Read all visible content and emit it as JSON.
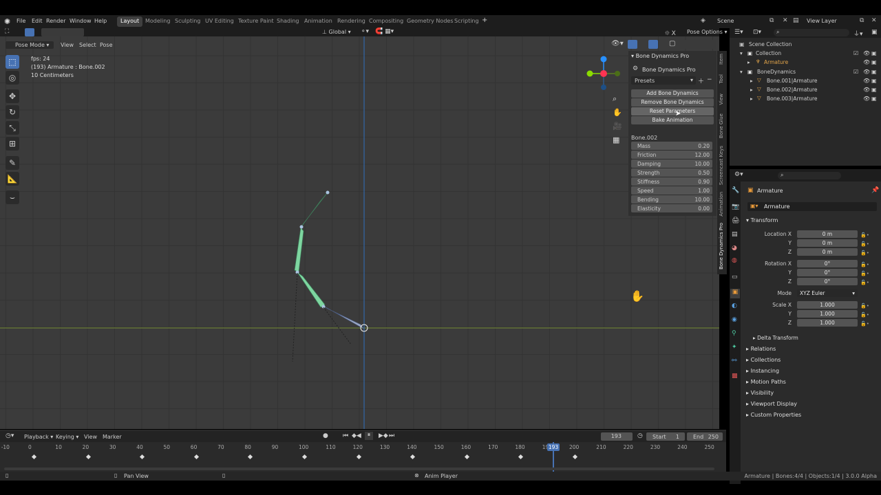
{
  "menu": [
    "File",
    "Edit",
    "Render",
    "Window",
    "Help"
  ],
  "workspaces": [
    {
      "label": "Layout",
      "active": true
    },
    {
      "label": "Modeling"
    },
    {
      "label": "Sculpting"
    },
    {
      "label": "UV Editing"
    },
    {
      "label": "Texture Paint"
    },
    {
      "label": "Shading"
    },
    {
      "label": "Animation"
    },
    {
      "label": "Rendering"
    },
    {
      "label": "Compositing"
    },
    {
      "label": "Geometry Nodes"
    },
    {
      "label": "Scripting"
    }
  ],
  "add_tab": "+",
  "scene": {
    "label": "Scene",
    "view_layer": "View Layer"
  },
  "viewport": {
    "mode": "Pose Mode",
    "menus": [
      "View",
      "Select",
      "Pose"
    ],
    "orientation": "Global",
    "pose_options": "Pose Options",
    "overlay": [
      "fps: 24",
      "(193) Armature : Bone.002",
      "10 Centimeters"
    ],
    "tabs": [
      "Item",
      "Tool",
      "View",
      "Bone Glue",
      "Screencast Keys",
      "Animation",
      "Bone Dynamics Pro"
    ]
  },
  "npanel": {
    "section": "Bone Dynamics Pro",
    "addon_title": "Bone Dynamics Pro",
    "presets": "Presets",
    "buttons": [
      "Add Bone Dynamics",
      "Remove Bone Dynamics",
      "Reset Parameters",
      "Bake Animation"
    ],
    "bone": "Bone.002",
    "params": [
      {
        "label": "Mass",
        "value": "0.20"
      },
      {
        "label": "Friction",
        "value": "12.00"
      },
      {
        "label": "Damping",
        "value": "10.00"
      },
      {
        "label": "Strength",
        "value": "0.50"
      },
      {
        "label": "Stiffness",
        "value": "0.90"
      },
      {
        "label": "Speed",
        "value": "1.00"
      },
      {
        "label": "Bending",
        "value": "10.00"
      },
      {
        "label": "Elasticity",
        "value": "0.00"
      }
    ]
  },
  "outliner": {
    "items": [
      {
        "label": "Scene Collection",
        "indent": 0
      },
      {
        "label": "Collection",
        "indent": 1
      },
      {
        "label": "Armature",
        "indent": 2,
        "highlight": true
      },
      {
        "label": "BoneDynamics",
        "indent": 1
      },
      {
        "label": "Bone.001|Armature",
        "indent": 2
      },
      {
        "label": "Bone.002|Armature",
        "indent": 2
      },
      {
        "label": "Bone.003|Armature",
        "indent": 2
      }
    ]
  },
  "properties": {
    "context": "Armature",
    "datablock": "Armature",
    "transform_title": "Transform",
    "location": {
      "label": "Location X",
      "y": "Y",
      "z": "Z",
      "values": [
        "0 m",
        "0 m",
        "0 m"
      ]
    },
    "rotation": {
      "label": "Rotation X",
      "y": "Y",
      "z": "Z",
      "values": [
        "0°",
        "0°",
        "0°"
      ]
    },
    "mode": {
      "label": "Mode",
      "value": "XYZ Euler"
    },
    "scale": {
      "label": "Scale X",
      "y": "Y",
      "z": "Z",
      "values": [
        "1.000",
        "1.000",
        "1.000"
      ]
    },
    "delta": "Delta Transform",
    "sections": [
      "Relations",
      "Collections",
      "Instancing",
      "Motion Paths",
      "Visibility",
      "Viewport Display",
      "Custom Properties"
    ]
  },
  "timeline": {
    "menus": [
      "Playback",
      "Keying",
      "View",
      "Marker"
    ],
    "current_frame": "193",
    "start_label": "Start",
    "start": "1",
    "end_label": "End",
    "end": "250",
    "ticks": [
      "-10",
      "0",
      "10",
      "20",
      "30",
      "40",
      "50",
      "60",
      "70",
      "80",
      "90",
      "100",
      "110",
      "120",
      "130",
      "140",
      "150",
      "160",
      "170",
      "180",
      "190",
      "200",
      "210",
      "220",
      "230",
      "240",
      "250"
    ],
    "playhead_label": "193",
    "keyframes": [
      0,
      20,
      40,
      60,
      80,
      100,
      120,
      140,
      160,
      180,
      200
    ]
  },
  "status": {
    "pan": "Pan View",
    "player": "Anim Player",
    "stats": "Armature | Bones:4/4 | Objects:1/4 | 3.0.0 Alpha"
  },
  "colors": {
    "accent": "#4772b3",
    "bone": "#7ed6a0",
    "x_axis": "#ff3352",
    "y_axis": "#8bdc00",
    "z_axis": "#2890ff"
  }
}
